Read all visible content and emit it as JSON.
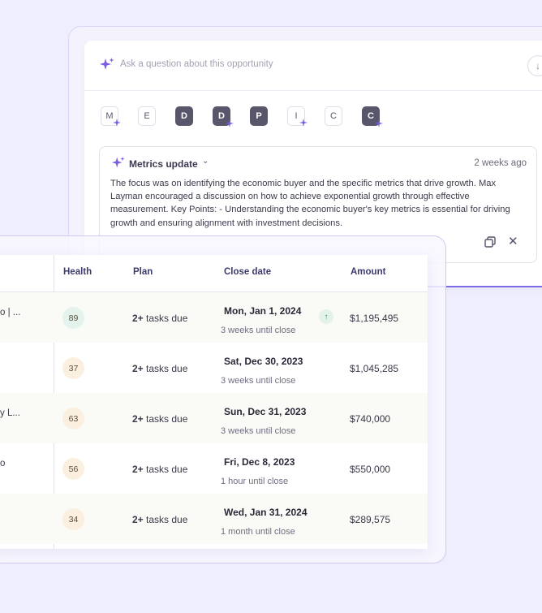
{
  "assistant": {
    "placeholder": "Ask a question about this opportunity",
    "letters": [
      {
        "label": "M",
        "style": "light",
        "spark": true
      },
      {
        "label": "E",
        "style": "light",
        "spark": false
      },
      {
        "label": "D",
        "style": "dark",
        "spark": false
      },
      {
        "label": "D",
        "style": "dark",
        "spark": true
      },
      {
        "label": "P",
        "style": "dark",
        "spark": false
      },
      {
        "label": "I",
        "style": "light",
        "spark": true
      },
      {
        "label": "C",
        "style": "light",
        "spark": false
      },
      {
        "label": "C",
        "style": "dark",
        "spark": true
      }
    ],
    "update": {
      "title": "Metrics update",
      "time": "2 weeks ago",
      "body": "The focus was on identifying the economic buyer and the specific metrics that drive growth. Max Layman encouraged a discussion on how to achieve exponential growth through effective measurement. Key Points: - Understanding the economic buyer's key metrics is essential for driving growth and ensuring alignment with investment decisions."
    }
  },
  "table": {
    "headers": {
      "health": "Health",
      "plan": "Plan",
      "close_date": "Close date",
      "amount": "Amount"
    },
    "rows": [
      {
        "name": "o | ...",
        "health": "89",
        "health_color": "#e4f3ec",
        "plan_strong": "2+",
        "plan_rest": " tasks due",
        "close_date": "Mon, Jan 1, 2024",
        "close_sub": "3 weeks until close",
        "amount": "$1,195,495",
        "trend": "↑"
      },
      {
        "name": "",
        "health": "37",
        "health_color": "#fbefdf",
        "plan_strong": "2+",
        "plan_rest": " tasks due",
        "close_date": "Sat, Dec 30, 2023",
        "close_sub": "3 weeks until close",
        "amount": "$1,045,285"
      },
      {
        "name": "y L...",
        "health": "63",
        "health_color": "#fbefdf",
        "plan_strong": "2+",
        "plan_rest": " tasks due",
        "close_date": "Sun, Dec 31, 2023",
        "close_sub": "3 weeks until close",
        "amount": "$740,000"
      },
      {
        "name": "o",
        "health": "56",
        "health_color": "#fbefdf",
        "plan_strong": "2+",
        "plan_rest": " tasks due",
        "close_date": "Fri, Dec 8, 2023",
        "close_sub": "1 hour until close",
        "amount": "$550,000"
      },
      {
        "name": "",
        "health": "34",
        "health_color": "#fbefdf",
        "plan_strong": "2+",
        "plan_rest": " tasks due",
        "close_date": "Wed, Jan 31, 2024",
        "close_sub": "1 month until close",
        "amount": "$289,575"
      }
    ]
  },
  "colors": {
    "accent": "#7b6be6",
    "spark": "#7b5ce0",
    "dark_chip": "#58566a",
    "background": "#efeefc"
  }
}
